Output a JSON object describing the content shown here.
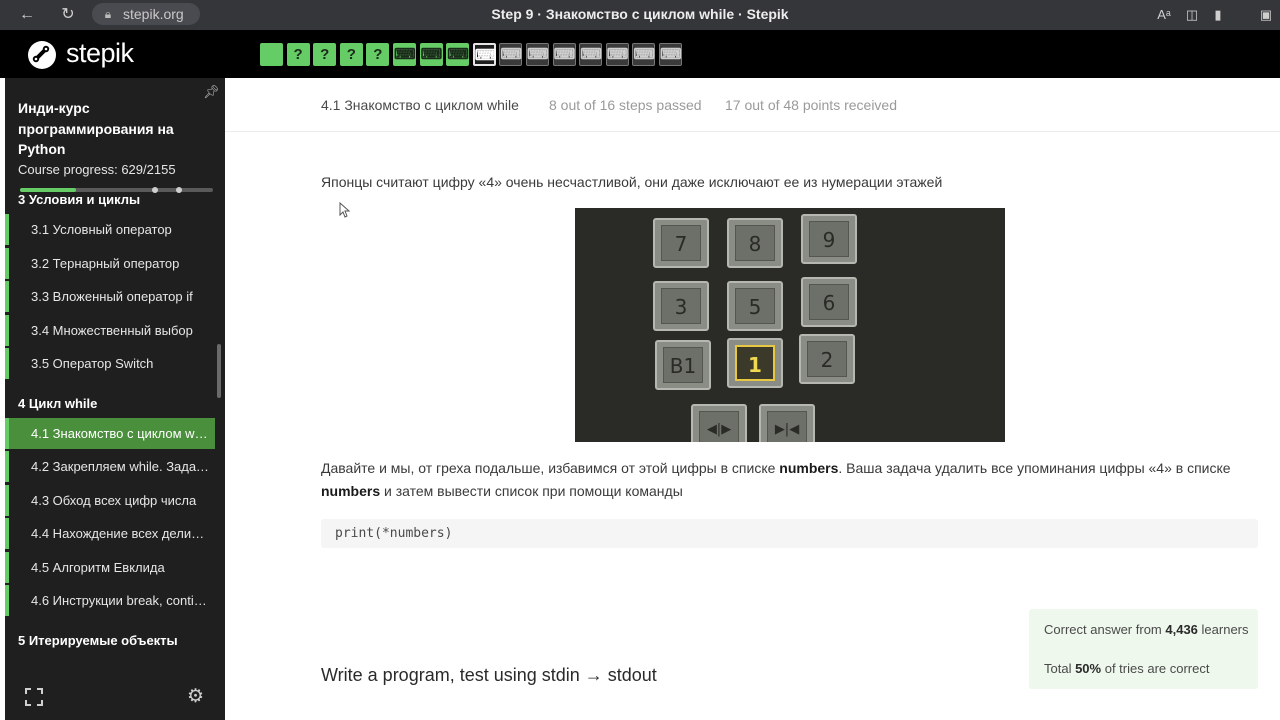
{
  "browser": {
    "url": "stepik.org",
    "tab_title": "Step 9 · Знакомство с циклом while · Stepik"
  },
  "topbar": {
    "logo_text": "stepik",
    "steps": [
      {
        "state": "done",
        "symbol": ""
      },
      {
        "state": "done",
        "symbol": "?"
      },
      {
        "state": "done",
        "symbol": "?"
      },
      {
        "state": "done",
        "symbol": "?"
      },
      {
        "state": "done",
        "symbol": "?"
      },
      {
        "state": "done",
        "symbol": "⌨"
      },
      {
        "state": "done",
        "symbol": "⌨"
      },
      {
        "state": "done",
        "symbol": "⌨"
      },
      {
        "state": "current",
        "symbol": "⌨"
      },
      {
        "state": "todo",
        "symbol": "⌨"
      },
      {
        "state": "todo",
        "symbol": "⌨"
      },
      {
        "state": "todo",
        "symbol": "⌨"
      },
      {
        "state": "todo",
        "symbol": "⌨"
      },
      {
        "state": "todo",
        "symbol": "⌨"
      },
      {
        "state": "todo",
        "symbol": "⌨"
      },
      {
        "state": "todo",
        "symbol": "⌨"
      }
    ]
  },
  "sidebar": {
    "course_title": "Инди-курс программирования на Python",
    "progress_label": "Course progress:  629/2155",
    "progress_fraction": 0.29,
    "sections": [
      {
        "label": "3  Условия и циклы",
        "lessons": [
          {
            "label": "3.1  Условный оператор",
            "active": false
          },
          {
            "label": "3.2  Тернарный оператор",
            "active": false
          },
          {
            "label": "3.3  Вложенный оператор if",
            "active": false
          },
          {
            "label": "3.4  Множественный выбор",
            "active": false
          },
          {
            "label": "3.5  Оператор Switch",
            "active": false
          }
        ]
      },
      {
        "label": "4  Цикл while",
        "lessons": [
          {
            "label": "4.1  Знакомство с циклом while",
            "active": true
          },
          {
            "label": "4.2  Закрепляем while. Задачи",
            "active": false
          },
          {
            "label": "4.3  Обход всех цифр числа",
            "active": false
          },
          {
            "label": "4.4  Нахождение всех делителей",
            "active": false
          },
          {
            "label": "4.5  Алгоритм Евклида",
            "active": false
          },
          {
            "label": "4.6  Инструкции break, continue",
            "active": false
          }
        ]
      },
      {
        "label": "5  Итерируемые объекты",
        "lessons": []
      }
    ]
  },
  "main": {
    "lesson_title": "4.1 Знакомство с циклом while",
    "steps_passed": "8 out of 16 steps passed",
    "points_received": "17 out of 48 points  received",
    "intro_text": "Японцы считают цифру «4» очень несчастливой, они даже исключают ее из нумерации этажей",
    "elevator_buttons": [
      "7",
      "8",
      "9",
      "3",
      "5",
      "6",
      "B1",
      "1",
      "2"
    ],
    "body_part1": "Давайте и мы, от греха подальше, избавимся от этой цифры в списке ",
    "body_bold1": "numbers",
    "body_part2": ". Ваша задача удалить все упоминания цифры «4» в списке ",
    "body_bold2": "numbers",
    "body_part3": " и затем вывести список при помощи команды",
    "code": "print(*numbers)",
    "stats": {
      "prefix": "Correct answer from ",
      "learners_count": "4,436",
      "learners_suffix": " learners",
      "total_prefix": "Total ",
      "percent": "50%",
      "total_suffix": " of tries are correct"
    },
    "task_heading": "Write a program, test using stdin → stdout"
  }
}
